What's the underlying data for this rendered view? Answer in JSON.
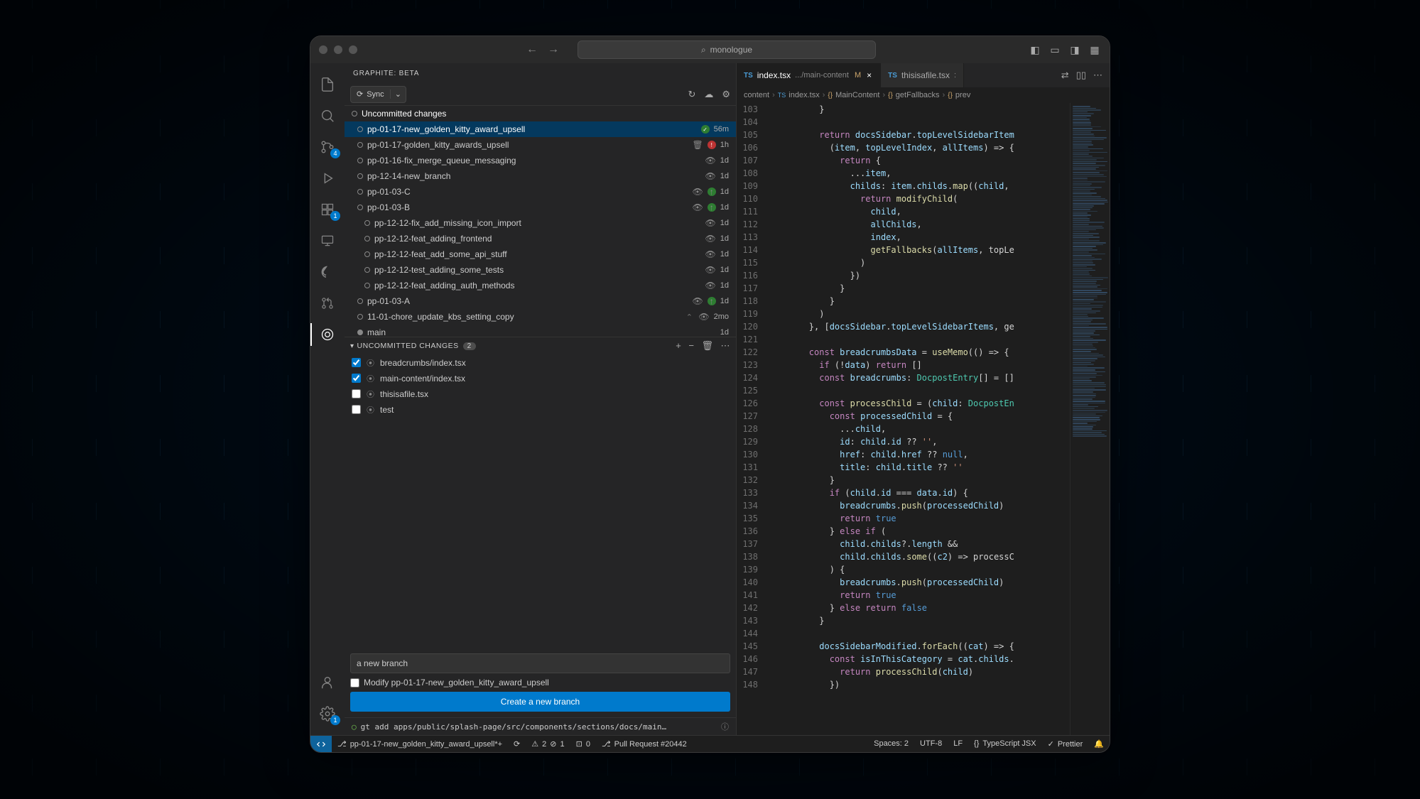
{
  "search": {
    "placeholder": "monologue"
  },
  "sidebar": {
    "title": "GRAPHITE: BETA",
    "sync_label": "Sync",
    "tree_header": "Uncommitted changes",
    "branches": [
      {
        "name": "pp-01-17-new_golden_kitty_award_upsell",
        "time": "56m",
        "selected": true,
        "badge": "green",
        "trash": false,
        "eye": false
      },
      {
        "name": "pp-01-17-golden_kitty_awards_upsell",
        "time": "1h",
        "badge": "red",
        "trash": true,
        "eye": false
      },
      {
        "name": "pp-01-16-fix_merge_queue_messaging",
        "time": "1d",
        "eye": true
      },
      {
        "name": "pp-12-14-new_branch",
        "time": "1d",
        "eye": true
      },
      {
        "name": "pp-01-03-C",
        "time": "1d",
        "badge": "green-up",
        "eye": true
      },
      {
        "name": "pp-01-03-B",
        "time": "1d",
        "badge": "green-up",
        "eye": true
      },
      {
        "name": "pp-12-12-fix_add_missing_icon_import",
        "time": "1d",
        "eye": true,
        "indent": true
      },
      {
        "name": "pp-12-12-feat_adding_frontend",
        "time": "1d",
        "eye": true,
        "indent": true
      },
      {
        "name": "pp-12-12-feat_add_some_api_stuff",
        "time": "1d",
        "eye": true,
        "indent": true
      },
      {
        "name": "pp-12-12-test_adding_some_tests",
        "time": "1d",
        "eye": true,
        "indent": true
      },
      {
        "name": "pp-12-12-feat_adding_auth_methods",
        "time": "1d",
        "eye": true,
        "indent": true
      },
      {
        "name": "pp-01-03-A",
        "time": "1d",
        "badge": "green-up",
        "eye": true
      },
      {
        "name": "11-01-chore_update_kbs_setting_copy",
        "time": "2mo",
        "eye": true,
        "collapse": true
      },
      {
        "name": "main",
        "time": "1d",
        "eye": false,
        "node": "filled"
      }
    ],
    "changes_header": "UNCOMMITTED CHANGES",
    "changes_count": "2",
    "changes": [
      {
        "file": "breadcrumbs/index.tsx",
        "checked": true,
        "modified": true
      },
      {
        "file": "main-content/index.tsx",
        "checked": true,
        "modified": true
      },
      {
        "file": "thisisafile.tsx",
        "checked": false,
        "untracked": true
      },
      {
        "file": "test",
        "checked": false,
        "untracked": true
      }
    ],
    "commit_placeholder": "a new branch",
    "modify_label": "Modify pp-01-17-new_golden_kitty_award_upsell",
    "create_label": "Create a new branch",
    "terminal": "gt add apps/public/splash-page/src/components/sections/docs/main…"
  },
  "tabs": [
    {
      "label": "index.tsx",
      "detail": ".../main-content",
      "modified": "M",
      "active": true
    },
    {
      "label": "thisisafile.tsx",
      "detail": ":"
    }
  ],
  "breadcrumb": [
    "content",
    "index.tsx",
    "MainContent",
    "getFallbacks",
    "prev"
  ],
  "code": {
    "start": 103,
    "lines": [
      "          }",
      "",
      "          return docsSidebar.topLevelSidebarItem",
      "            (item, topLevelIndex, allItems) => {",
      "              return {",
      "                ...item,",
      "                childs: item.childs.map((child,",
      "                  return modifyChild(",
      "                    child,",
      "                    allChilds,",
      "                    index,",
      "                    getFallbacks(allItems, topLe",
      "                  )",
      "                })",
      "              }",
      "            }",
      "          )",
      "        }, [docsSidebar.topLevelSidebarItems, ge",
      "",
      "        const breadcrumbsData = useMemo(() => {",
      "          if (!data) return []",
      "          const breadcrumbs: DocpostEntry[] = []",
      "",
      "          const processChild = (child: DocpostEn",
      "            const processedChild = {",
      "              ...child,",
      "              id: child.id ?? '',",
      "              href: child.href ?? null,",
      "              title: child.title ?? ''",
      "            }",
      "            if (child.id === data.id) {",
      "              breadcrumbs.push(processedChild)",
      "              return true",
      "            } else if (",
      "              child.childs?.length &&",
      "              child.childs.some((c2) => processC",
      "            ) {",
      "              breadcrumbs.push(processedChild)",
      "              return true",
      "            } else return false",
      "          }",
      "",
      "          docsSidebarModified.forEach((cat) => {",
      "            const isInThisCategory = cat.childs.",
      "              return processChild(child)",
      "            })"
    ]
  },
  "status": {
    "branch": "pp-01-17-new_golden_kitty_award_upsell*+",
    "sync": "⟳",
    "problems_warn": "2",
    "problems_err": "1",
    "ports": "0",
    "pr": "Pull Request #20442",
    "spaces": "Spaces: 2",
    "encoding": "UTF-8",
    "eol": "LF",
    "lang": "TypeScript JSX",
    "prettier": "Prettier"
  },
  "activity_badges": {
    "scm": "4",
    "ext": "1",
    "settings": "1"
  }
}
